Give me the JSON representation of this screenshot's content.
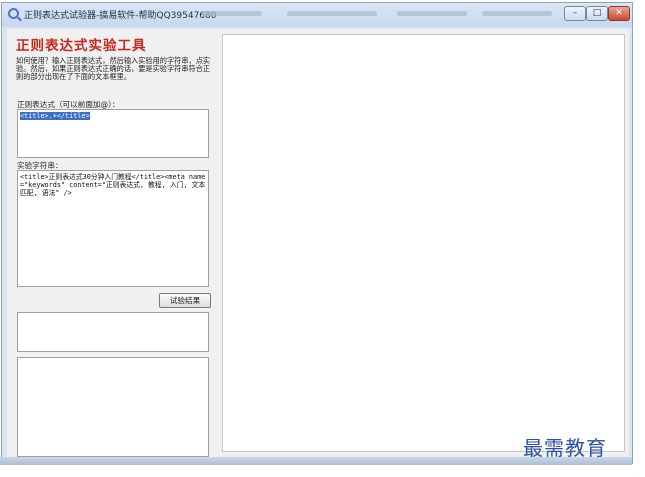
{
  "window": {
    "title": "正则表达式试验器-搞易软件-帮助QQ39547680",
    "controls": {
      "minimize": "–",
      "maximize": "□",
      "close": "✕"
    }
  },
  "left_panel": {
    "app_title": "正则表达式实验工具",
    "help_text": "如何使用？输入正则表达式，然后输入实验用的字符串，点实验。然后，如果正则表达式正确的话，要是实验字符串符合正则的部分出现在了下面的文本框里。",
    "regex_label": "正则表达式（可以前面加@）：",
    "regex_value": "<title>.+</title>",
    "test_label": "实验字符串：",
    "test_value": "<title>正则表达式30分钟入门教程</title><meta name=\"keywords\" content=\"正则表达式, 教程, 入门, 文本匹配, 语法\" />",
    "test_button": "试验结果",
    "result_value_1": "",
    "result_value_2": ""
  },
  "watermark": "最需教育",
  "colors": {
    "title_red": "#c8281c",
    "selection": "#3a6fc6",
    "watermark": "#2d4fa6"
  }
}
